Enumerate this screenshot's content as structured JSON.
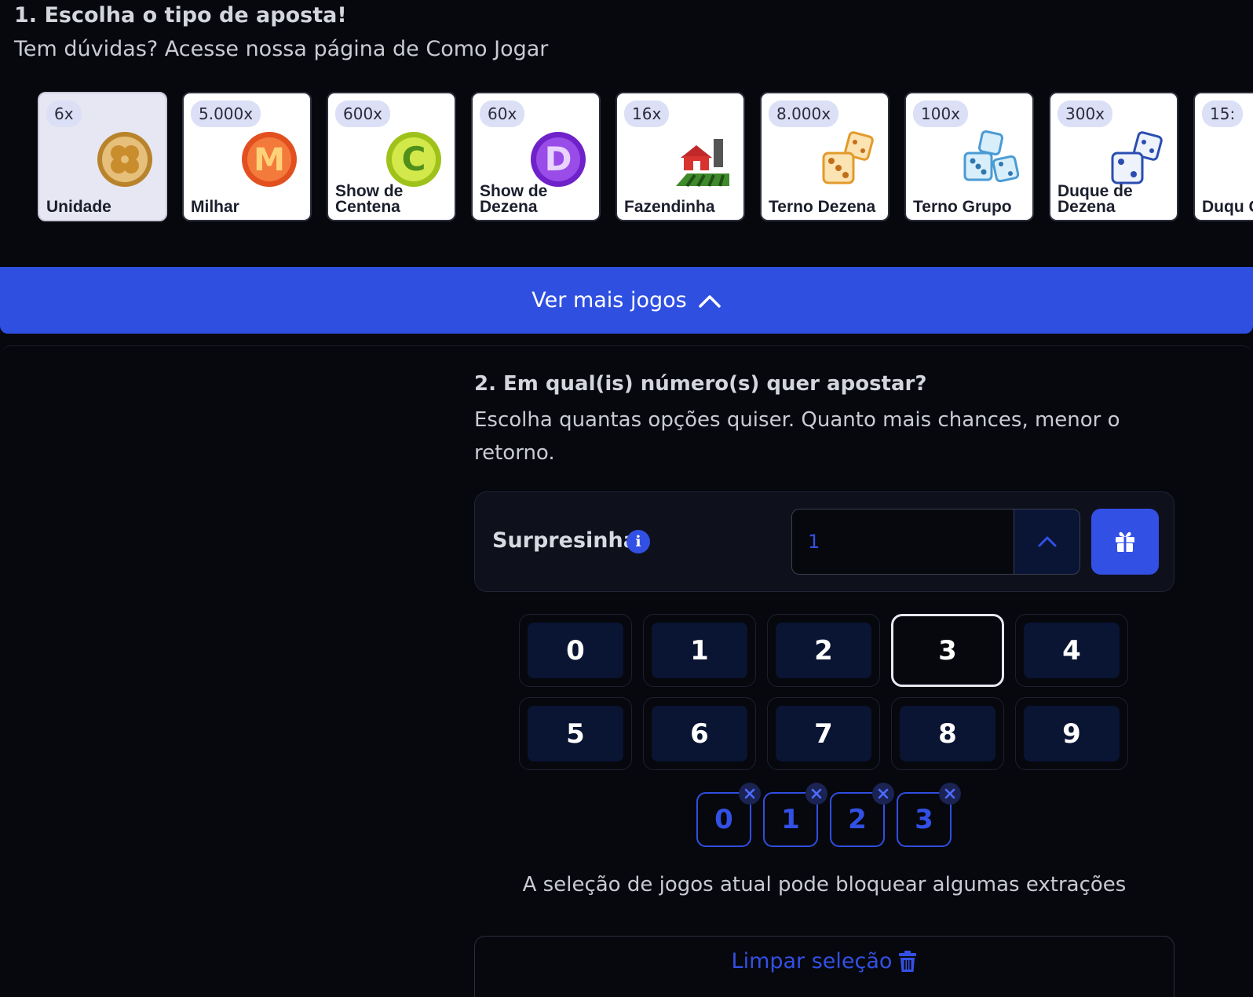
{
  "section1": {
    "title": "1. Escolha o tipo de aposta!",
    "subtitle": "Tem dúvidas? Acesse nossa página de Como Jogar"
  },
  "bet_types": [
    {
      "multiplier": "6x",
      "label": "Unidade",
      "icon": "clover-coin-icon",
      "selected": true
    },
    {
      "multiplier": "5.000x",
      "label": "Milhar",
      "icon": "letter-m-icon"
    },
    {
      "multiplier": "600x",
      "label": "Show de Centena",
      "icon": "letter-c-icon"
    },
    {
      "multiplier": "60x",
      "label": "Show de Dezena",
      "icon": "letter-d-icon"
    },
    {
      "multiplier": "16x",
      "label": "Fazendinha",
      "icon": "farm-icon"
    },
    {
      "multiplier": "8.000x",
      "label": "Terno Dezena",
      "icon": "dice-orange-icon"
    },
    {
      "multiplier": "100x",
      "label": "Terno Grupo",
      "icon": "dice-blue-icon"
    },
    {
      "multiplier": "300x",
      "label": "Duque de Dezena",
      "icon": "dice-navy-icon"
    },
    {
      "multiplier": "15:",
      "label": "Duqu Grup",
      "icon": "partial-card"
    }
  ],
  "ver_mais": {
    "label": "Ver mais jogos"
  },
  "section2": {
    "title": "2. Em qual(is) número(s) quer apostar?",
    "subtitle": "Escolha quantas opções quiser. Quanto mais chances, menor o retorno."
  },
  "surpresinha": {
    "label": "Surpresinha",
    "quantity": "1"
  },
  "numpad": {
    "keys": [
      "0",
      "1",
      "2",
      "3",
      "4",
      "5",
      "6",
      "7",
      "8",
      "9"
    ],
    "highlighted": "3"
  },
  "selected_numbers": [
    "0",
    "1",
    "2",
    "3"
  ],
  "warning": "A seleção de jogos atual pode bloquear algumas extrações",
  "clear_button": {
    "label": "Limpar seleção"
  },
  "colors": {
    "accent": "#3350e5",
    "background": "#07080d",
    "panel": "#0e111c",
    "key": "#0a1433"
  }
}
